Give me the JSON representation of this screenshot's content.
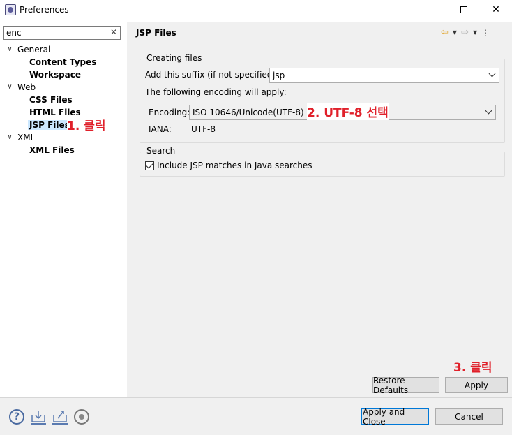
{
  "window": {
    "title": "Preferences"
  },
  "filter": {
    "value": "enc"
  },
  "tree": {
    "general": "General",
    "content_types": "Content Types",
    "workspace": "Workspace",
    "web": "Web",
    "css_files": "CSS Files",
    "html_files": "HTML Files",
    "jsp_files": "JSP Files",
    "xml": "XML",
    "xml_files": "XML Files"
  },
  "annotations": {
    "step1": "1. 클릭",
    "step2": "2. UTF-8 선택",
    "step3": "3. 클릭"
  },
  "page": {
    "title": "JSP Files",
    "creating_files": {
      "legend": "Creating files",
      "suffix_label": "Add this suffix (if not specified):",
      "suffix_value": "jsp",
      "encoding_note": "The following encoding will apply:",
      "encoding_label": "Encoding:",
      "encoding_value": "ISO 10646/Unicode(UTF-8)",
      "iana_label": "IANA:",
      "iana_value": "UTF-8"
    },
    "search": {
      "legend": "Search",
      "include_label": "Include JSP matches in Java searches",
      "include_checked": true
    }
  },
  "buttons": {
    "restore_defaults": "Restore Defaults",
    "apply": "Apply",
    "apply_and_close": "Apply and Close",
    "cancel": "Cancel"
  },
  "icons": {
    "help": "help-icon",
    "import": "import-icon",
    "export": "export-icon",
    "record": "record-icon",
    "back": "back-arrow-icon",
    "forward": "forward-arrow-icon",
    "menu": "view-menu-icon"
  },
  "colors": {
    "annotation": "#e0202a",
    "selection": "#cce8ff",
    "default_button_border": "#0078d7"
  }
}
